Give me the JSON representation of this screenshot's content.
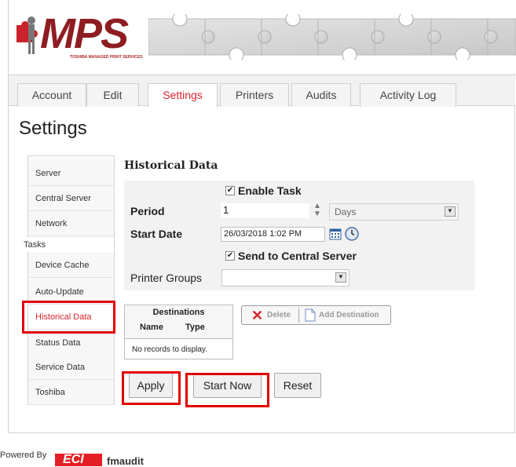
{
  "header": {
    "logo_text": "MPS",
    "logo_subtext": "TOSHIBA MANAGED PRINT SERVICES"
  },
  "tabs": [
    {
      "label": "Account"
    },
    {
      "label": "Edit"
    },
    {
      "label": "Settings"
    },
    {
      "label": "Printers"
    },
    {
      "label": "Audits"
    },
    {
      "label": "Activity Log"
    }
  ],
  "page_title": "Settings",
  "sidebar": {
    "items_top": [
      {
        "label": "Server"
      },
      {
        "label": "Central Server"
      },
      {
        "label": "Network"
      }
    ],
    "group_label": "Tasks",
    "items_tasks": [
      {
        "label": "Device Cache"
      },
      {
        "label": "Auto-Update"
      },
      {
        "label": "Historical Data"
      },
      {
        "label": "Status Data"
      },
      {
        "label": "Service Data"
      },
      {
        "label": "Toshiba"
      }
    ]
  },
  "form": {
    "section_title": "Historical Data",
    "enable_task_label": "Enable Task",
    "enable_task_checked": true,
    "period_label": "Period",
    "period_value": "1",
    "period_unit": "Days",
    "start_date_label": "Start Date",
    "start_date_value": "26/03/2018 1:02 PM",
    "send_central_label": "Send to Central Server",
    "send_central_checked": true,
    "printer_groups_label": "Printer Groups",
    "printer_groups_value": ""
  },
  "destinations": {
    "title": "Destinations",
    "columns": [
      "Name",
      "Type"
    ],
    "empty_text": "No records to display."
  },
  "dest_buttons": {
    "delete_label": "Delete",
    "add_label": "Add Destination"
  },
  "actions": {
    "apply_label": "Apply",
    "start_now_label": "Start Now",
    "reset_label": "Reset"
  },
  "footer": {
    "powered_by": "Powered By",
    "eci_label": "ECI",
    "fmaudit_label": "fmaudit"
  },
  "colors": {
    "accent": "#d8242e",
    "highlight": "#e10000"
  }
}
